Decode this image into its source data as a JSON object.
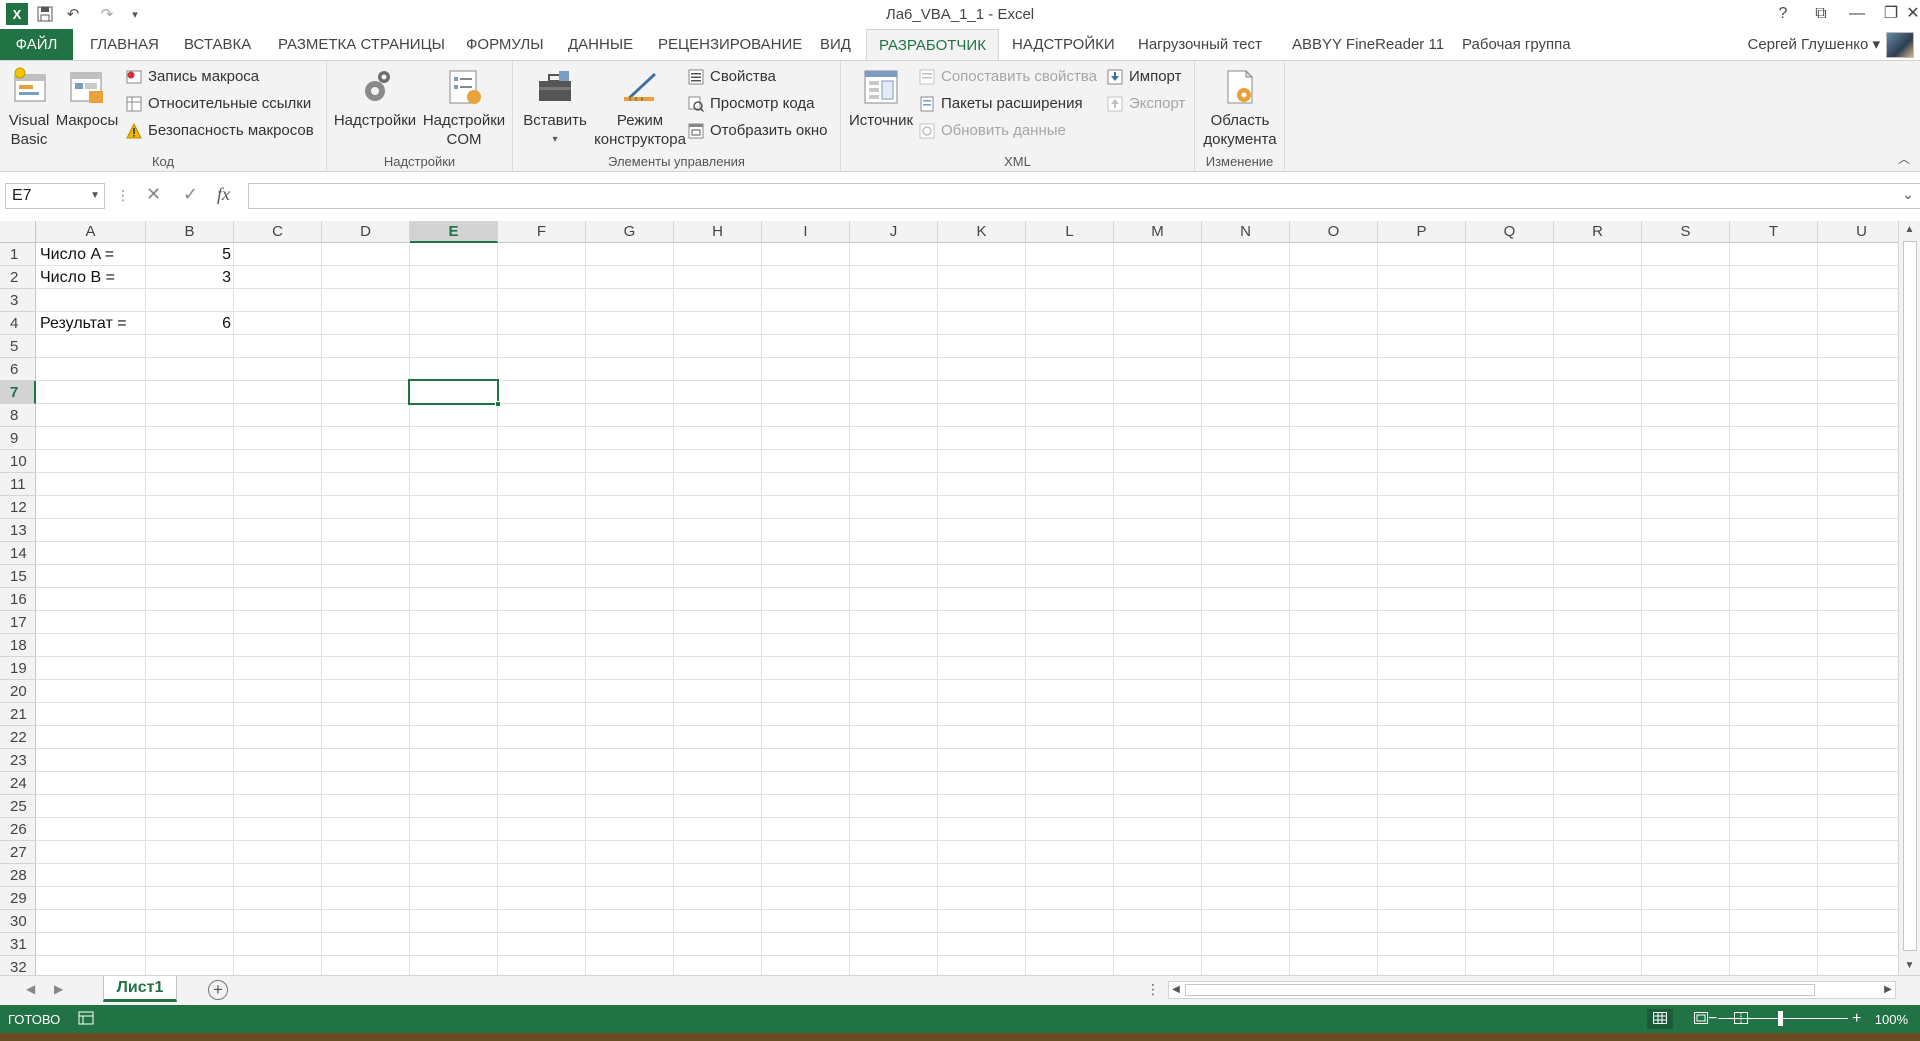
{
  "window": {
    "title": "Ла6_VBA_1_1 - Excel",
    "help": "?",
    "restore_ribbon": "⧉",
    "minimize": "—",
    "maximize": "❐",
    "close": "✕",
    "qat": {
      "undo": "↶",
      "redo": "↷",
      "customize": "▾"
    }
  },
  "tabs": {
    "file": "ФАЙЛ",
    "items": [
      "ГЛАВНАЯ",
      "ВСТАВКА",
      "РАЗМЕТКА СТРАНИЦЫ",
      "ФОРМУЛЫ",
      "ДАННЫЕ",
      "РЕЦЕНЗИРОВАНИЕ",
      "ВИД",
      "РАЗРАБОТЧИК",
      "НАДСТРОЙКИ",
      "Нагрузочный тест",
      "ABBYY FineReader 11",
      "Рабочая группа"
    ],
    "active": "РАЗРАБОТЧИК",
    "user": "Сергей Глушенко ▾"
  },
  "ribbon": {
    "code": {
      "label": "Код",
      "visual_basic": "Visual\nBasic",
      "visual_basic_l1": "Visual",
      "visual_basic_l2": "Basic",
      "macros": "Макросы",
      "record_macro": "Запись макроса",
      "relative_refs": "Относительные ссылки",
      "macro_security": "Безопасность макросов"
    },
    "addins": {
      "label": "Надстройки",
      "addins": "Надстройки",
      "com_l1": "Надстройки",
      "com_l2": "COM"
    },
    "controls": {
      "label": "Элементы управления",
      "insert": "Вставить",
      "design_l1": "Режим",
      "design_l2": "конструктора",
      "properties": "Свойства",
      "view_code": "Просмотр кода",
      "run_dialog": "Отобразить окно"
    },
    "xml": {
      "label": "XML",
      "source": "Источник",
      "map_properties": "Сопоставить свойства",
      "expansion_packs": "Пакеты расширения",
      "refresh_data": "Обновить данные",
      "import": "Импорт",
      "export": "Экспорт"
    },
    "modify": {
      "label": "Изменение",
      "doc_panel_l1": "Область",
      "doc_panel_l2": "документа"
    }
  },
  "formula_bar": {
    "name_box": "E7",
    "cancel": "✕",
    "enter": "✓",
    "fx": "fx",
    "value": ""
  },
  "grid": {
    "columns": [
      "A",
      "B",
      "C",
      "D",
      "E",
      "F",
      "G",
      "H",
      "I",
      "J",
      "K",
      "L",
      "M",
      "N",
      "O",
      "P",
      "Q",
      "R",
      "S",
      "T",
      "U"
    ],
    "rows": [
      "1",
      "2",
      "3",
      "4",
      "5",
      "6",
      "7",
      "8",
      "9",
      "10",
      "11",
      "12",
      "13",
      "14",
      "15",
      "16",
      "17",
      "18",
      "19",
      "20",
      "21",
      "22",
      "23",
      "24",
      "25",
      "26",
      "27",
      "28",
      "29",
      "30",
      "31",
      "32"
    ],
    "selected_cell": "E7",
    "cells": {
      "A1": "Число A =",
      "B1": "5",
      "A2": "Число B =",
      "B2": "3",
      "A4": "Результат =",
      "B4": "6"
    }
  },
  "sheets": {
    "active": "Лист1",
    "add": "+"
  },
  "status": {
    "ready": "ГОТОВО",
    "zoom": "100%",
    "zoom_minus": "−",
    "zoom_plus": "+"
  },
  "colors": {
    "accent": "#217346",
    "ribbon_bg": "#f3f3f3"
  }
}
